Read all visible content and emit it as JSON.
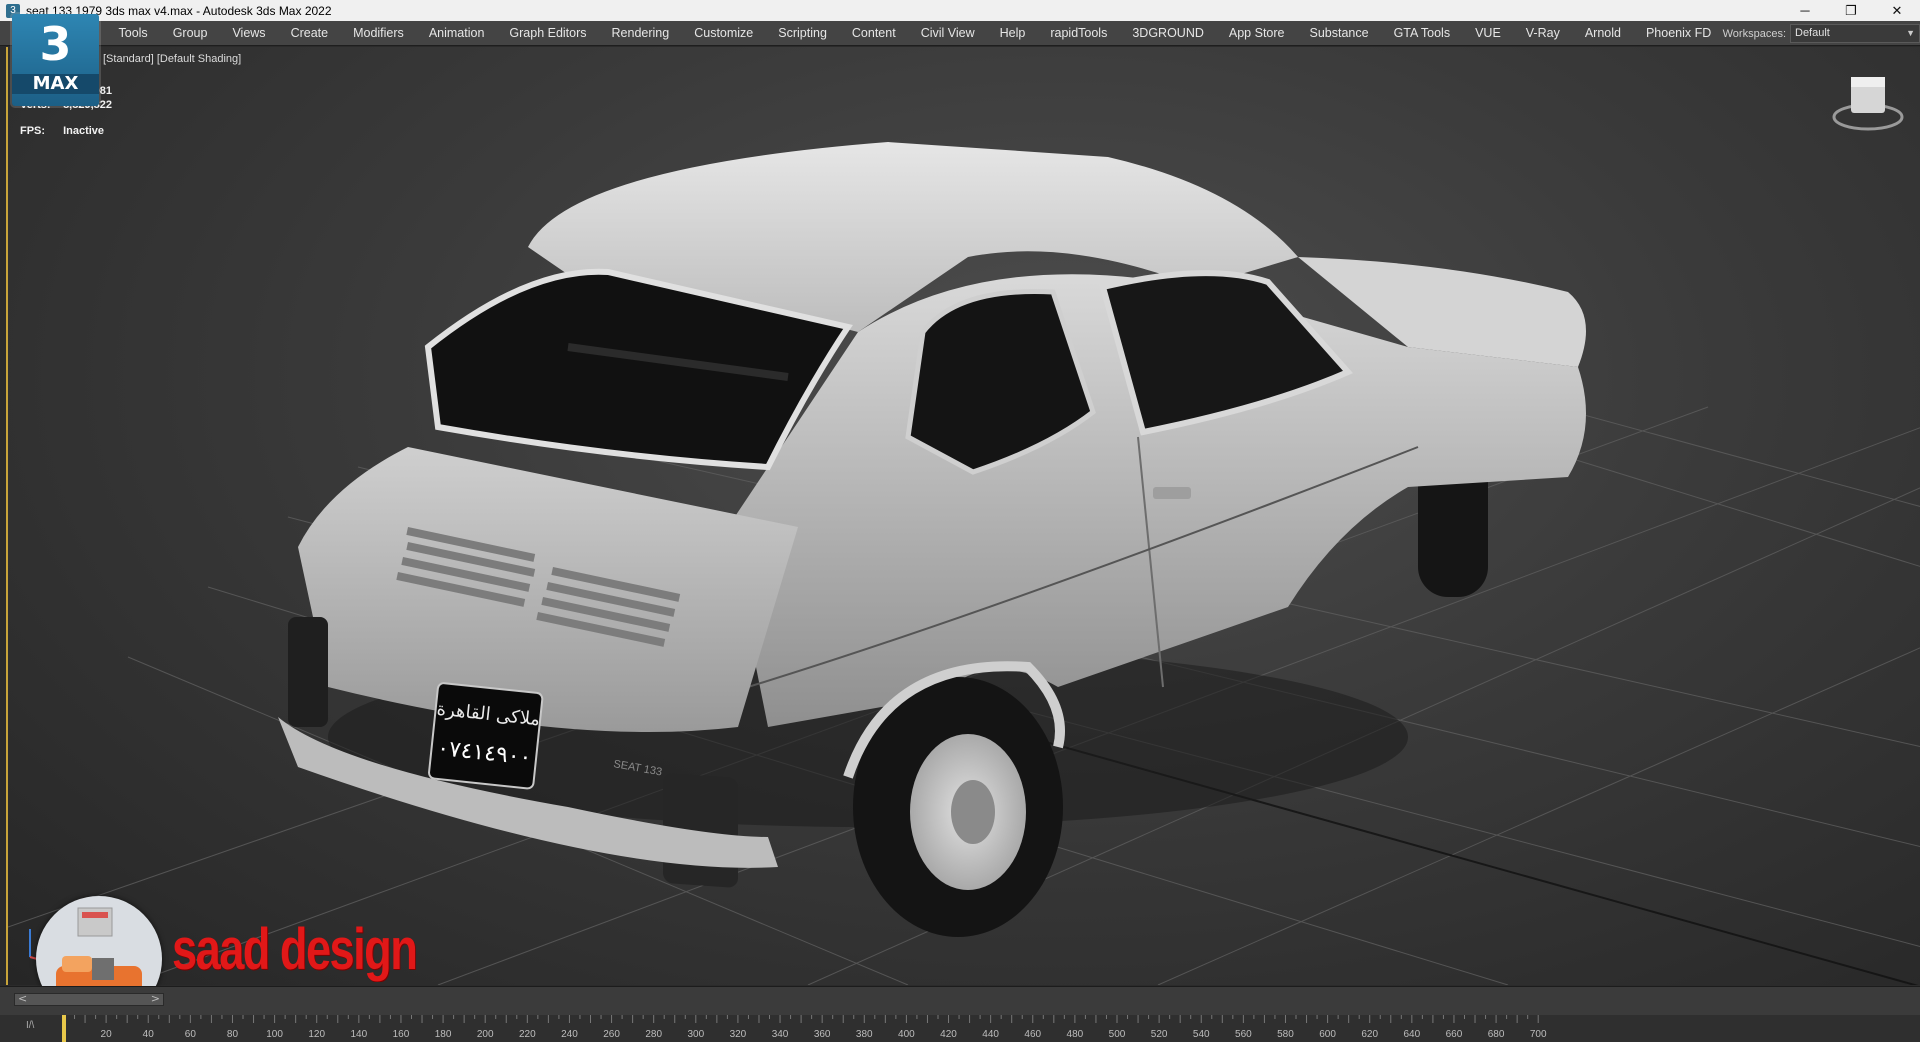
{
  "window": {
    "title": "seat 133 1979 3ds max v4.max - Autodesk 3ds Max 2022",
    "minimize_glyph": "─",
    "restore_glyph": "❐",
    "close_glyph": "✕"
  },
  "menu": {
    "items": [
      "Tools",
      "Group",
      "Views",
      "Create",
      "Modifiers",
      "Animation",
      "Graph Editors",
      "Rendering",
      "Customize",
      "Scripting",
      "Content",
      "Civil View",
      "Help",
      "rapidTools",
      "3DGROUND",
      "App Store",
      "Substance",
      "GTA Tools",
      "VUE",
      "V-Ray",
      "Arnold",
      "Phoenix FD"
    ],
    "workspaces_label": "Workspaces:",
    "workspaces_value": "Default"
  },
  "logo": {
    "number": "3",
    "word": "MAX"
  },
  "viewport": {
    "label": "[Standard] [Default Shading]",
    "stats": [
      {
        "key": "Polys:",
        "value": "8,338,081"
      },
      {
        "key": "Verts:",
        "value": "8,829,822"
      }
    ],
    "fps_key": "FPS:",
    "fps_value": "Inactive",
    "license_plate": "٠٧٤١٤٩٠٠",
    "plate_city": "ملاكى القاهرة",
    "badge": "SEAT 133"
  },
  "watermark": {
    "text": "saad design"
  },
  "timeline": {
    "ticks": [
      20,
      40,
      60,
      80,
      100,
      120,
      140,
      160,
      180,
      200,
      220,
      240,
      260,
      280,
      300,
      320,
      340,
      360,
      380,
      400,
      420,
      440,
      460,
      480,
      500,
      520,
      540,
      560,
      580,
      600,
      620,
      640,
      660,
      680,
      700
    ],
    "prev_glyph": "<",
    "next_glyph": ">",
    "corner_label": "I/\\"
  },
  "colors": {
    "menu_bg": "#444444",
    "viewport_border": "#c8a43a",
    "watermark": "#e11818"
  }
}
